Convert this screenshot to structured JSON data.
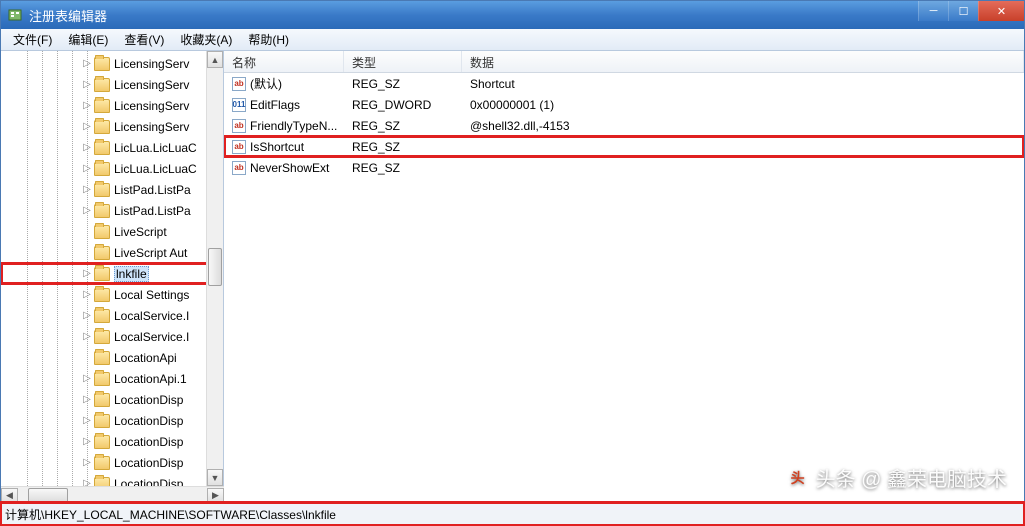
{
  "window": {
    "title": "注册表编辑器"
  },
  "menu": {
    "file": "文件(F)",
    "edit": "编辑(E)",
    "view": "查看(V)",
    "fav": "收藏夹(A)",
    "help": "帮助(H)"
  },
  "tree": {
    "items": [
      {
        "label": "LicensingServ",
        "exp": "▷"
      },
      {
        "label": "LicensingServ",
        "exp": "▷"
      },
      {
        "label": "LicensingServ",
        "exp": "▷"
      },
      {
        "label": "LicensingServ",
        "exp": "▷"
      },
      {
        "label": "LicLua.LicLuaC",
        "exp": "▷"
      },
      {
        "label": "LicLua.LicLuaC",
        "exp": "▷"
      },
      {
        "label": "ListPad.ListPa",
        "exp": "▷"
      },
      {
        "label": "ListPad.ListPa",
        "exp": "▷"
      },
      {
        "label": "LiveScript",
        "exp": ""
      },
      {
        "label": "LiveScript Aut",
        "exp": ""
      },
      {
        "label": "lnkfile",
        "exp": "▷",
        "selected": true,
        "hl": true
      },
      {
        "label": "Local Settings",
        "exp": "▷"
      },
      {
        "label": "LocalService.I",
        "exp": "▷"
      },
      {
        "label": "LocalService.I",
        "exp": "▷"
      },
      {
        "label": "LocationApi",
        "exp": ""
      },
      {
        "label": "LocationApi.1",
        "exp": "▷"
      },
      {
        "label": "LocationDisp",
        "exp": "▷"
      },
      {
        "label": "LocationDisp",
        "exp": "▷"
      },
      {
        "label": "LocationDisp",
        "exp": "▷"
      },
      {
        "label": "LocationDisp",
        "exp": "▷"
      },
      {
        "label": "LocationDisp",
        "exp": "▷"
      }
    ]
  },
  "list": {
    "headers": {
      "name": "名称",
      "type": "类型",
      "data": "数据"
    },
    "rows": [
      {
        "icon": "str",
        "name": "(默认)",
        "type": "REG_SZ",
        "data": "Shortcut"
      },
      {
        "icon": "bin",
        "name": "EditFlags",
        "type": "REG_DWORD",
        "data": "0x00000001 (1)"
      },
      {
        "icon": "str",
        "name": "FriendlyTypeN...",
        "type": "REG_SZ",
        "data": "@shell32.dll,-4153"
      },
      {
        "icon": "str",
        "name": "IsShortcut",
        "type": "REG_SZ",
        "data": "",
        "hl": true
      },
      {
        "icon": "str",
        "name": "NeverShowExt",
        "type": "REG_SZ",
        "data": ""
      }
    ]
  },
  "status": {
    "path": "计算机\\HKEY_LOCAL_MACHINE\\SOFTWARE\\Classes\\lnkfile"
  },
  "watermark": {
    "text": "头条 @ 鑫荣电脑技术"
  }
}
